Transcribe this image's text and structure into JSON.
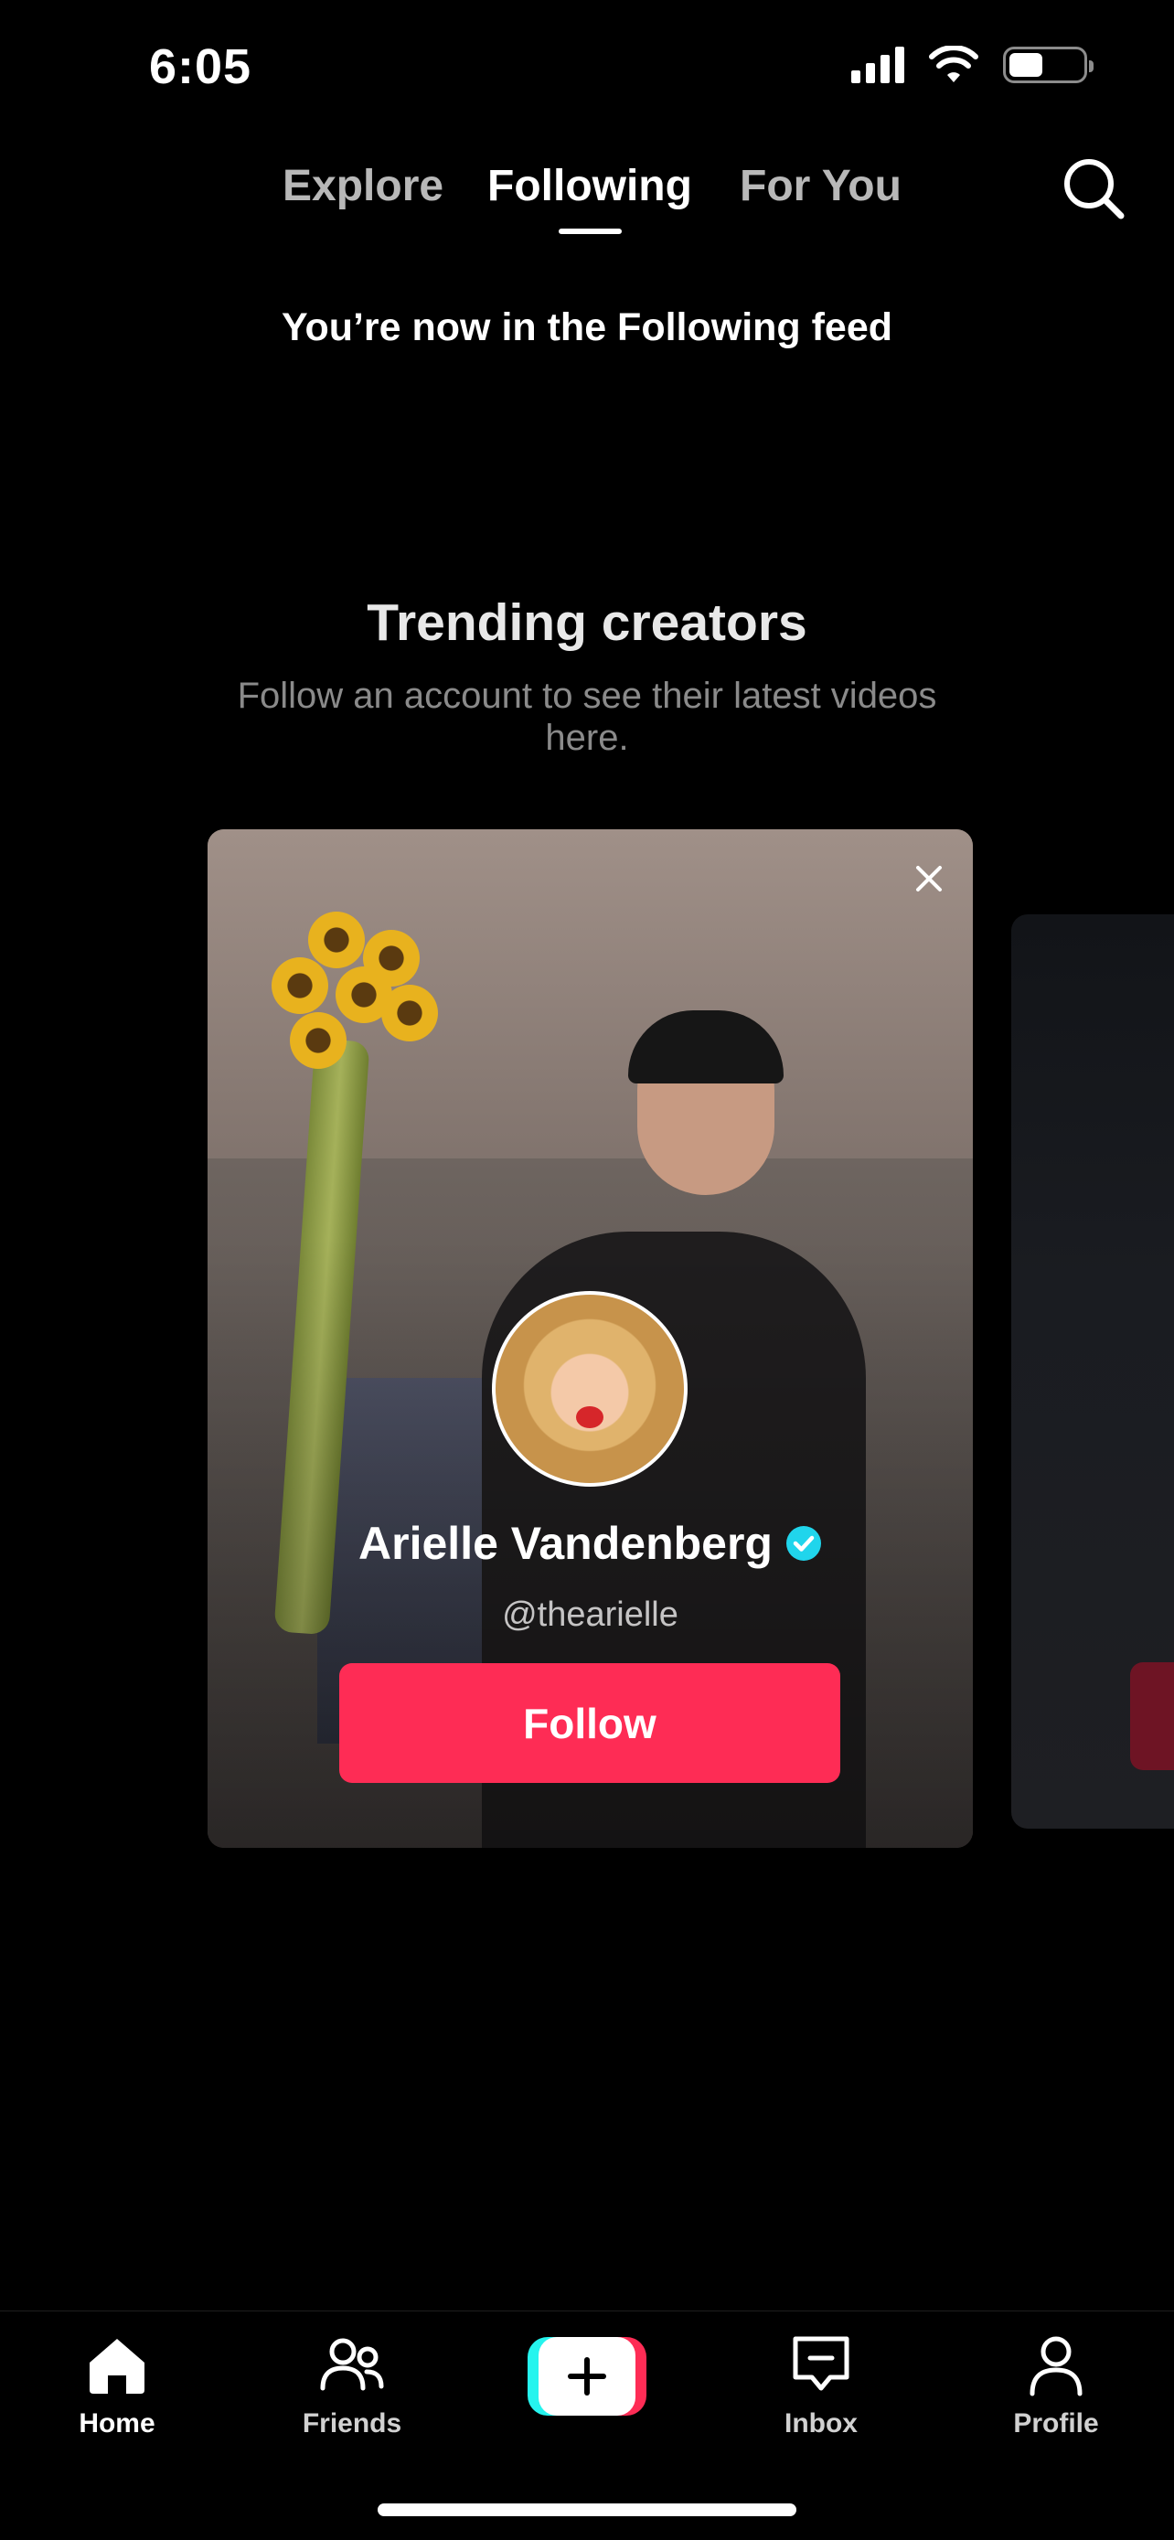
{
  "status_bar": {
    "time": "6:05"
  },
  "top_tabs": {
    "explore": "Explore",
    "following": "Following",
    "for_you": "For You",
    "active": "Following"
  },
  "feed_banner": "You’re now in the Following feed",
  "trending": {
    "title": "Trending creators",
    "subtitle": "Follow an account to see their latest videos here."
  },
  "creator_card": {
    "name": "Arielle Vandenberg",
    "handle": "@thearielle",
    "verified": true,
    "follow_label": "Follow"
  },
  "bottom_nav": {
    "home": "Home",
    "friends": "Friends",
    "create_icon": "plus-icon",
    "inbox": "Inbox",
    "profile": "Profile",
    "active": "Home"
  },
  "colors": {
    "accent": "#fe2c55",
    "secondary_accent": "#25f4ee",
    "verified": "#20d5ec",
    "background": "#000000"
  }
}
